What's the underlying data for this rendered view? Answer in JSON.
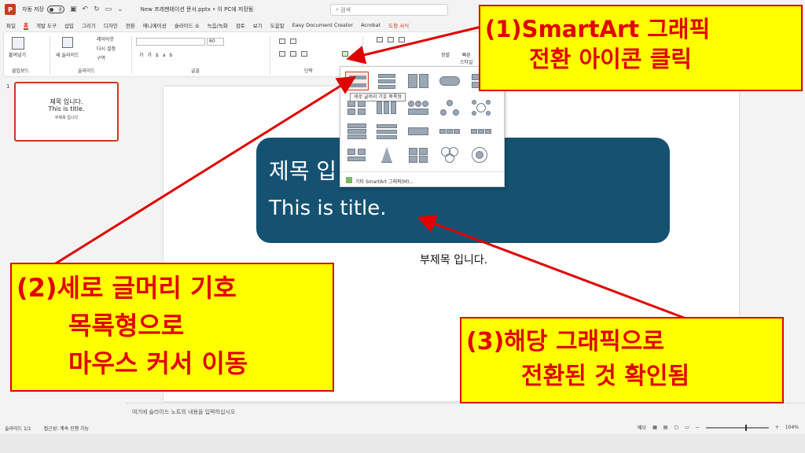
{
  "titlebar": {
    "autosave_label": "자동 저장",
    "toggle_label": "끔",
    "document_title": "New 프레젠테이션 문서.pptx • 이 PC에 저장됨",
    "search_placeholder": "검색"
  },
  "tabs": [
    "파일",
    "홈",
    "개발 도구",
    "삽입",
    "그리기",
    "디자인",
    "전환",
    "애니메이션",
    "슬라이드 쇼",
    "녹음/녹화",
    "검토",
    "보기",
    "도움말",
    "Easy Document Creator",
    "Acrobat",
    "도형 서식"
  ],
  "ribbon": {
    "clipboard": {
      "paste_label": "붙여넣기",
      "group_label": "클립보드"
    },
    "slides": {
      "new_slide_label": "새 슬라이드",
      "layout_label": "레이아웃",
      "reset_label": "다시 설정",
      "section_label": "구역",
      "group_label": "슬라이드"
    },
    "font": {
      "size_value": "60",
      "group_label": "글꼴"
    },
    "paragraph": {
      "group_label": "단락"
    },
    "drawing": {
      "arrange_label": "정렬",
      "quick_styles_line1": "빠른",
      "quick_styles_line2": "스타일"
    }
  },
  "slide_panel": {
    "slide_number": "1",
    "thumbnail_title": "제목 입니다.",
    "thumbnail_subtitle_en": "This is title.",
    "thumbnail_subtitle": "부제목 입니다"
  },
  "slide": {
    "title_line1": "제목 입",
    "title_line2": "This is title.",
    "subtitle": "부제목 입니다."
  },
  "smartart_menu": {
    "tooltip": "세로 글머리 기호 목록형",
    "more_label": "기타 SmartArt 그래픽(M)..."
  },
  "notes_placeholder": "여기에 슬라이드 노트의 내용을 입력하십시오",
  "status": {
    "slide_info": "슬라이드 1/1",
    "accessibility": "접근성: 계속 진행 가능",
    "notes_label": "메모",
    "zoom": "104%"
  },
  "callouts": {
    "c1_line1": "(1)SmartArt 그래픽",
    "c1_line2": "전환 아이콘 클릭",
    "c2_line1": "(2)세로 글머리 기호",
    "c2_line2": "목록형으로",
    "c2_line3": "마우스 커서 이동",
    "c3_line1": "(3)해당 그래픽으로",
    "c3_line2": "전환된 것 확인됨"
  },
  "colors": {
    "accent": "#c43e1c",
    "title_box": "#155272",
    "callout_bg": "#ffff00",
    "callout_text": "#e00000"
  }
}
